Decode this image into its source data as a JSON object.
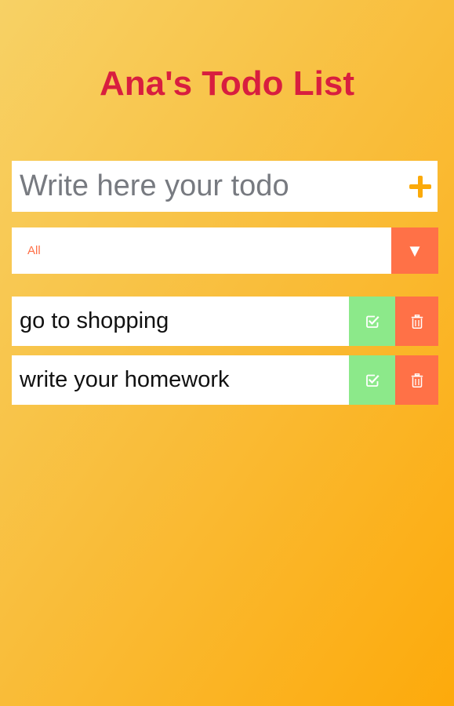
{
  "app": {
    "title": "Ana's Todo List"
  },
  "form": {
    "input_value": "",
    "input_placeholder": "Write here your todo",
    "add_icon": "plus-icon"
  },
  "filter": {
    "selected": "All",
    "arrow_glyph": "▼"
  },
  "todos": [
    {
      "text": "go to shopping",
      "complete_icon": "check-square-icon",
      "delete_icon": "trash-icon"
    },
    {
      "text": "write your homework",
      "complete_icon": "check-square-icon",
      "delete_icon": "trash-icon"
    }
  ],
  "colors": {
    "title": "#d81e3f",
    "accent": "#fbaa0a",
    "complete": "#8ce98a",
    "delete": "#ff7147",
    "filter_text": "#ff6f47"
  }
}
